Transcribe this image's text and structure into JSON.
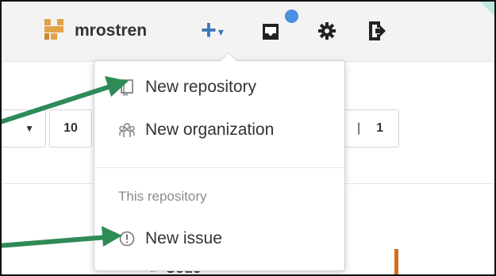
{
  "header": {
    "username": "mrostren",
    "create_icon": "plus-icon",
    "notifications_icon": "inbox-icon",
    "settings_icon": "gear-icon",
    "signout_icon": "sign-out-icon"
  },
  "background": {
    "pager_left": "10",
    "pager_right": "1",
    "code_tab": "<> Code"
  },
  "dropdown": {
    "items": [
      {
        "label": "New repository",
        "icon": "repo-icon"
      },
      {
        "label": "New organization",
        "icon": "organization-icon"
      }
    ],
    "section_header": "This repository",
    "section_items": [
      {
        "label": "New issue",
        "icon": "issue-icon"
      }
    ]
  },
  "colors": {
    "annotation_arrow": "#2e8b57",
    "link_blue": "#3a77b8",
    "notification_dot": "#4a8fe0"
  }
}
